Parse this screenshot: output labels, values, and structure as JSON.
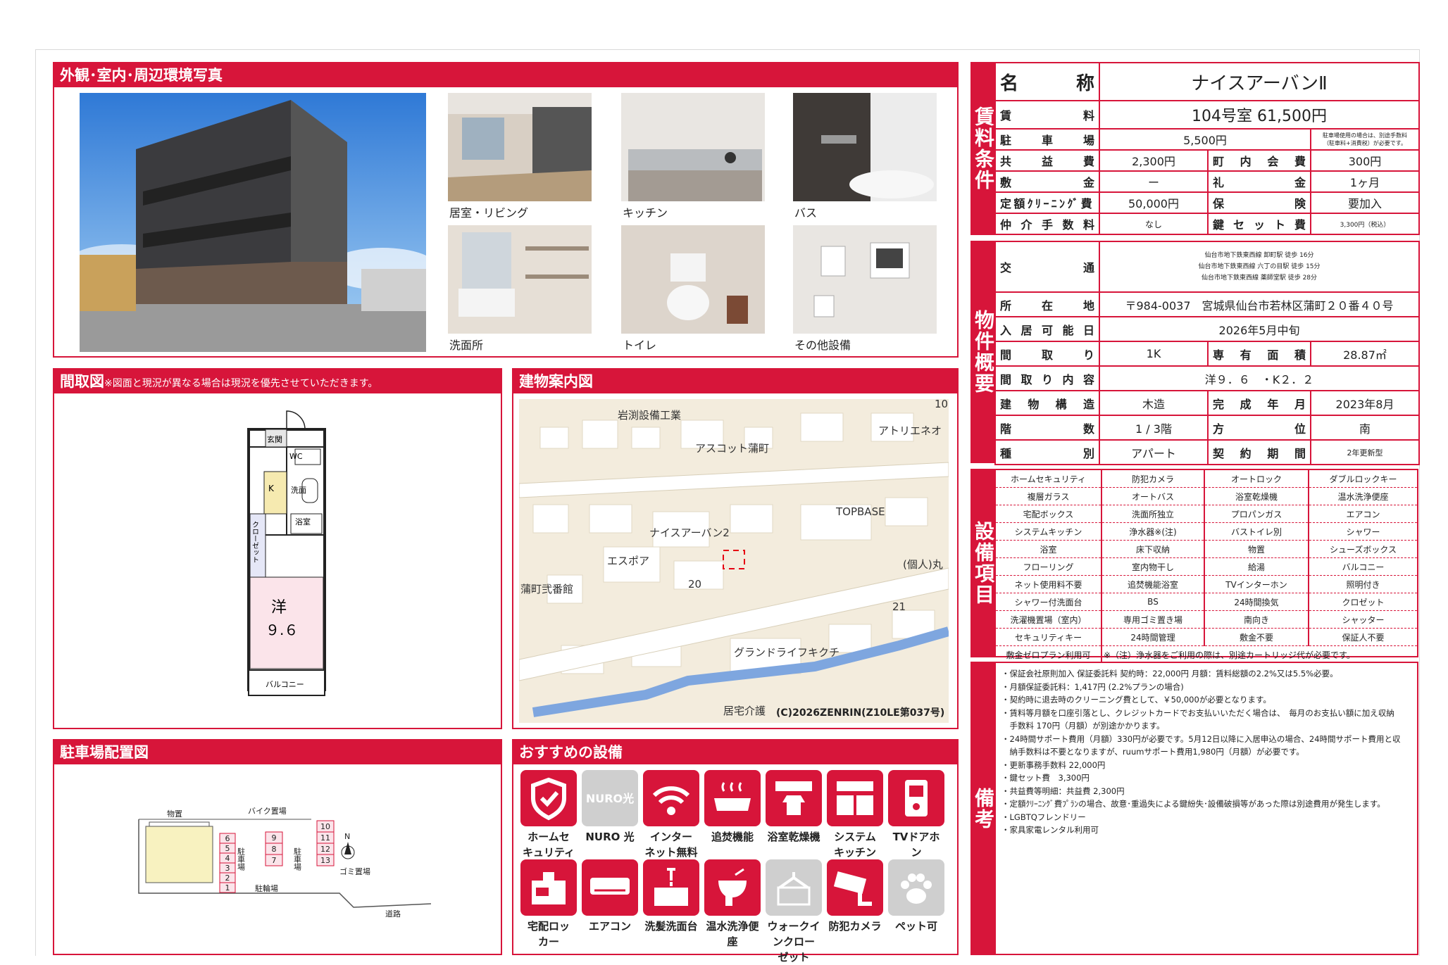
{
  "panels": {
    "photos_title": "外観･室内･周辺環境写真",
    "floorplan_title": "間取図",
    "floorplan_note": "※図面と現況が異なる場合は現況を優先させていただきます。",
    "map_title": "建物案内図",
    "parking_title": "駐車場配置図",
    "features_title": "おすすめの設備"
  },
  "photos": {
    "captions": [
      "居室・リビング",
      "キッチン",
      "バス",
      "洗面所",
      "トイレ",
      "その他設備"
    ]
  },
  "floorplan": {
    "genkan": "玄関",
    "wc": "WC",
    "kitchen": "K",
    "senmen": "洗面",
    "closet": "クローゼット",
    "bath": "浴室",
    "room": "洋",
    "size": "９.６",
    "balcony": "バルコニー"
  },
  "map": {
    "labels": [
      "岩渕設備工業",
      "アスコット蒲町",
      "アトリエネオ",
      "TOPBASE",
      "ナイスアーバン2",
      "エスポア",
      "(個人)丸",
      "蒲町弐番館",
      "グランドライフキクチ",
      "居宅介護"
    ],
    "numbers": [
      "20",
      "21",
      "10"
    ],
    "copyright": "(C)2026ZENRIN(Z10LE第037号)"
  },
  "parking": {
    "labels": [
      "物置",
      "バイク置場",
      "駐車場",
      "駐車場",
      "ゴミ置場",
      "駐輪場",
      "道路",
      "N"
    ],
    "spaces_left": [
      "6",
      "5",
      "4",
      "3",
      "2",
      "1"
    ],
    "spaces_mid": [
      "9",
      "8",
      "7"
    ],
    "spaces_right": [
      "10",
      "11",
      "12",
      "13"
    ]
  },
  "rent": {
    "section_label": "賃料条件",
    "name_label": "名　　称",
    "name": "ナイスアーバンⅡ",
    "rent_label": "賃　　料",
    "rent": "104号室 61,500円",
    "parking_label": "駐車場",
    "parking": "5,500円",
    "parking_note": "駐車場使用の場合は、別途手数料\n（駐車料+消費税）が必要です。",
    "common_label": "共益費",
    "common": "2,300円",
    "town_label": "町内会費",
    "town": "300円",
    "deposit_label": "敷金",
    "deposit": "ー",
    "key_money_label": "礼金",
    "key_money": "1ヶ月",
    "cleaning_label": "定額ｸﾘｰﾆﾝｸﾞ費",
    "cleaning": "50,000円",
    "insurance_label": "保険",
    "insurance": "要加入",
    "brokerage_label": "仲介手数料",
    "brokerage": "なし",
    "key_label": "鍵セット費",
    "key": "3,300円（税込）"
  },
  "overview": {
    "section_label": "物件概要",
    "transport_label": "交　　通",
    "transport": [
      "仙台市地下鉄東西線 卸町駅 徒歩 16分",
      "仙台市地下鉄東西線 六丁の目駅 徒歩 15分",
      "仙台市地下鉄東西線 薬師堂駅 徒歩 28分"
    ],
    "address_label": "所在地",
    "address": "〒984-0037　宮城県仙台市若林区蒲町２０番４０号",
    "move_in_label": "入居可能日",
    "move_in": "2026年5月中旬",
    "layout_label": "間取り",
    "layout": "1K",
    "area_label": "専有面積",
    "area": "28.87㎡",
    "layout_detail_label": "間取り内容",
    "layout_detail": "洋９．６　・K２．２",
    "structure_label": "建物構造",
    "structure": "木造",
    "built_label": "完成年月",
    "built": "2023年8月",
    "floor_label": "階数",
    "floor": "1 / 3階",
    "direction_label": "方位",
    "direction": "南",
    "type_label": "種別",
    "type": "アパート",
    "contract_label": "契約期間",
    "contract": "2年更新型"
  },
  "equipment": {
    "section_label": "設備項目",
    "rows": [
      [
        "ホームセキュリティ",
        "防犯カメラ",
        "オートロック",
        "ダブルロックキー"
      ],
      [
        "複層ガラス",
        "オートバス",
        "浴室乾燥機",
        "温水洗浄便座"
      ],
      [
        "宅配ボックス",
        "洗面所独立",
        "プロパンガス",
        "エアコン"
      ],
      [
        "システムキッチン",
        "浄水器※(注)",
        "バストイレ別",
        "シャワー"
      ],
      [
        "浴室",
        "床下収納",
        "物置",
        "シューズボックス"
      ],
      [
        "フローリング",
        "室内物干し",
        "給湯",
        "バルコニー"
      ],
      [
        "ネット使用料不要",
        "追焚機能浴室",
        "TVインターホン",
        "照明付き"
      ],
      [
        "シャワー付洗面台",
        "BS",
        "24時間換気",
        "クロゼット"
      ],
      [
        "洗濯機置場（室内）",
        "専用ゴミ置き場",
        "南向き",
        "シャッター"
      ],
      [
        "セキュリティキー",
        "24時間管理",
        "敷金不要",
        "保証人不要"
      ]
    ],
    "last_label": "敷金ゼロプラン利用可",
    "last_note": "※（注）浄水器をご利用の際は、別途カートリッジ代が必要です。"
  },
  "remarks": {
    "section_label": "備考",
    "lines": [
      "・保証会社原則加入 保証委託料 契約時：22,000円 月額：賃料総額の2.2%又は5.5%必要。",
      "・月額保証委託料：1,417円 (2.2%プランの場合)",
      "・契約時に退去時のクリーニング費として、￥50,000が必要となります。",
      "・賃料等月額を口座引落とし、クレジットカードでお支払いいただく場合は、　毎月のお支払い額に加え収納",
      "　手数料 170円（月額）が別途かかります。",
      "・24時間サポート費用（月額）330円が必要です。5月12日以降に入居申込の場合、24時間サポート費用と収",
      "　納手数料は不要となりますが、ruumサポート費用1,980円（月額）が必要です。",
      "・更新事務手数料 22,000円",
      "・鍵セット費　3,300円",
      "・共益費等明細：共益費 2,300円",
      "・定額ｸﾘｰﾆﾝｸﾞ費ﾌﾟﾗﾝの場合、故意･重過失による鍵紛失･設備破損等があった際は別途費用が発生します。",
      "・LGBTQフレンドリー",
      "・家具家電レンタル利用可"
    ]
  },
  "features": [
    {
      "label": "ホームセ\nキュリティ",
      "icon": "shield-icon"
    },
    {
      "label": "NURO 光",
      "icon": "nuro-icon"
    },
    {
      "label": "インター\nネット無料",
      "icon": "wifi-icon"
    },
    {
      "label": "追焚機能",
      "icon": "bathtub-icon"
    },
    {
      "label": "浴室乾燥機",
      "icon": "dryer-icon"
    },
    {
      "label": "システム\nキッチン",
      "icon": "kitchen-icon"
    },
    {
      "label": "TVドアホン",
      "icon": "intercom-icon"
    },
    {
      "label": "宅配ロッ\nカー",
      "icon": "locker-icon"
    },
    {
      "label": "エアコン",
      "icon": "aircon-icon"
    },
    {
      "label": "洗髪洗面台",
      "icon": "sink-icon"
    },
    {
      "label": "温水洗浄便\n座",
      "icon": "toilet-icon"
    },
    {
      "label": "ウォークイ\nンクロー\nゼット",
      "icon": "closet-icon"
    },
    {
      "label": "防犯カメラ",
      "icon": "camera-icon"
    },
    {
      "label": "ペット可",
      "icon": "paw-icon"
    }
  ],
  "colors": {
    "accent": "#d7153a",
    "disabled": "#cfcfcf"
  }
}
